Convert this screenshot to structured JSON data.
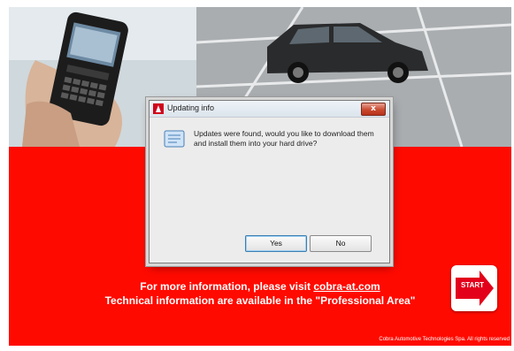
{
  "dialog": {
    "title": "Updating info",
    "close_label": "x",
    "message": "Updates were found, would you like to download them and install them into your hard drive?",
    "yes_label": "Yes",
    "no_label": "No"
  },
  "footer": {
    "info_prefix": "For more information, please visit ",
    "info_link": "cobra-at.com",
    "info_line2": "Technical information are available in the \"Professional Area\"",
    "start_label": "START",
    "copyright": "Cobra Automotive Technologies Spa. All rights reserved"
  },
  "colors": {
    "brand_red": "#ff0a00",
    "dialog_bg": "#ececec",
    "close_red": "#c9492f"
  },
  "icons": [
    "phone-photo",
    "car-photo",
    "app-icon",
    "message-icon",
    "close-icon",
    "start-arrow-icon"
  ]
}
